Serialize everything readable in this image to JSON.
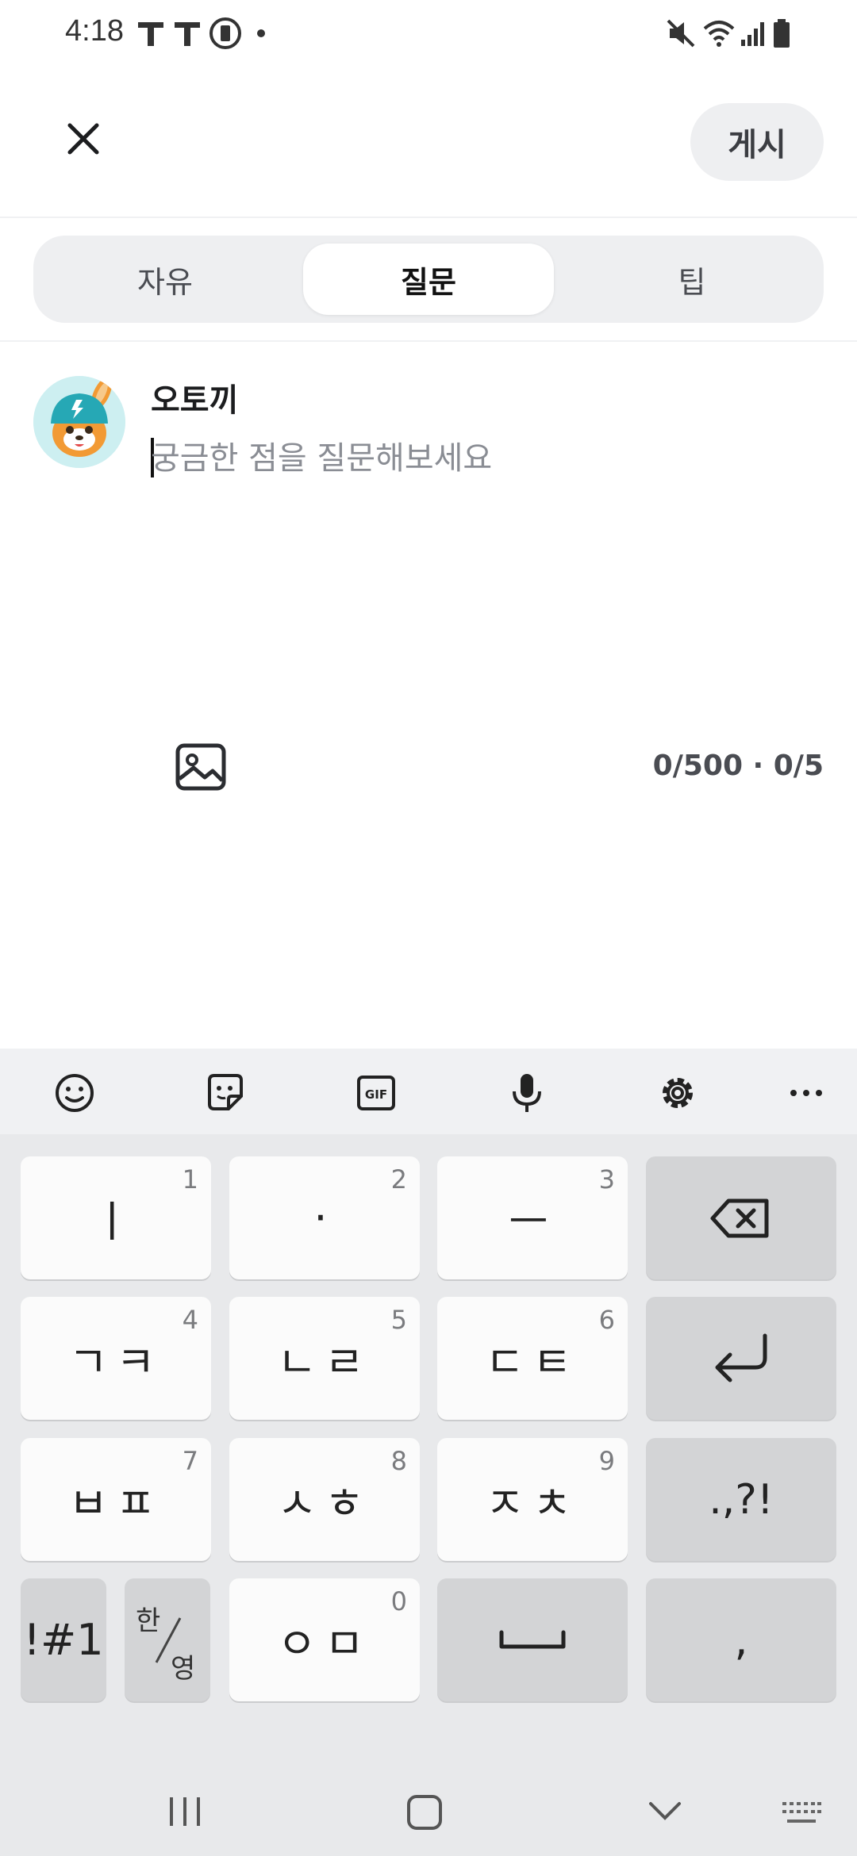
{
  "status_bar": {
    "time": "4:18"
  },
  "header": {
    "post_label": "게시"
  },
  "tabs": [
    {
      "label": "자유",
      "active": false
    },
    {
      "label": "질문",
      "active": true
    },
    {
      "label": "팁",
      "active": false
    }
  ],
  "author": {
    "name": "오토끼"
  },
  "editor": {
    "placeholder": "궁금한 점을 질문해보세요",
    "value": "",
    "counter": "0/500 · 0/5"
  },
  "keyboard": {
    "toolbar": [
      "emoji-icon",
      "sticker-icon",
      "gif-icon",
      "mic-icon",
      "settings-icon",
      "more-icon"
    ],
    "keys": {
      "k1": {
        "label": "ㅣ",
        "num": "1"
      },
      "k2": {
        "label": "·",
        "num": "2"
      },
      "k3": {
        "label": "ㅡ",
        "num": "3"
      },
      "k4": {
        "label": "ㄱㅋ",
        "num": "4"
      },
      "k5": {
        "label": "ㄴㄹ",
        "num": "5"
      },
      "k6": {
        "label": "ㄷㅌ",
        "num": "6"
      },
      "k7": {
        "label": "ㅂㅍ",
        "num": "7"
      },
      "k8": {
        "label": "ㅅㅎ",
        "num": "8"
      },
      "k9": {
        "label": "ㅈㅊ",
        "num": "9"
      },
      "k0": {
        "label": "ㅇㅁ",
        "num": "0"
      },
      "punct": ".,?!",
      "symbols": "!#1",
      "lang_top": "한",
      "lang_bottom": "영",
      "comma": ","
    }
  },
  "colors": {
    "accent_tab_bg": "#eeeff1",
    "keyboard_bg": "#e8e9eb"
  }
}
